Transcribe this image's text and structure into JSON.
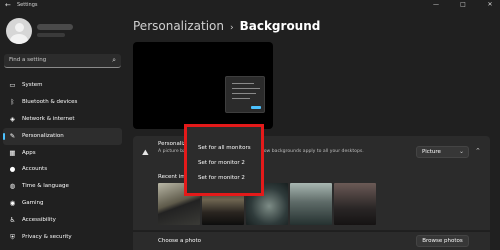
{
  "window": {
    "title": "Settings",
    "controls": {
      "minimize": "—",
      "maximize": "□",
      "close": "✕"
    }
  },
  "search": {
    "placeholder": "Find a setting",
    "icon": "search-icon"
  },
  "sidebar": {
    "accent": "#4cc2ff",
    "items": [
      {
        "label": "System",
        "icon": "system-icon",
        "glyph": "▭"
      },
      {
        "label": "Bluetooth & devices",
        "icon": "bluetooth-icon",
        "glyph": "ᛒ"
      },
      {
        "label": "Network & internet",
        "icon": "wifi-icon",
        "glyph": "◈"
      },
      {
        "label": "Personalization",
        "icon": "brush-icon",
        "glyph": "✎",
        "selected": true
      },
      {
        "label": "Apps",
        "icon": "apps-icon",
        "glyph": "▦"
      },
      {
        "label": "Accounts",
        "icon": "person-icon",
        "glyph": "●"
      },
      {
        "label": "Time & language",
        "icon": "globe-icon",
        "glyph": "◍"
      },
      {
        "label": "Gaming",
        "icon": "gaming-icon",
        "glyph": "◉"
      },
      {
        "label": "Accessibility",
        "icon": "accessibility-icon",
        "glyph": "♿"
      },
      {
        "label": "Privacy & security",
        "icon": "shield-icon",
        "glyph": "⛨"
      }
    ]
  },
  "breadcrumb": {
    "parent": "Personalization",
    "separator": "›",
    "current": "Background"
  },
  "card": {
    "heading": "Personalize y",
    "description": "A picture backs                                    desktop. Solid color or slideshow backgrounds apply to all your desktops.",
    "dropdown_value": "Picture",
    "recent_label": "Recent imag"
  },
  "menu": {
    "highlight_color": "#e41a1a",
    "items": [
      "Set for all monitors",
      "Set for monitor 2",
      "Set for monitor 2"
    ]
  },
  "browse": {
    "label": "Choose a photo",
    "button": "Browse photos"
  }
}
